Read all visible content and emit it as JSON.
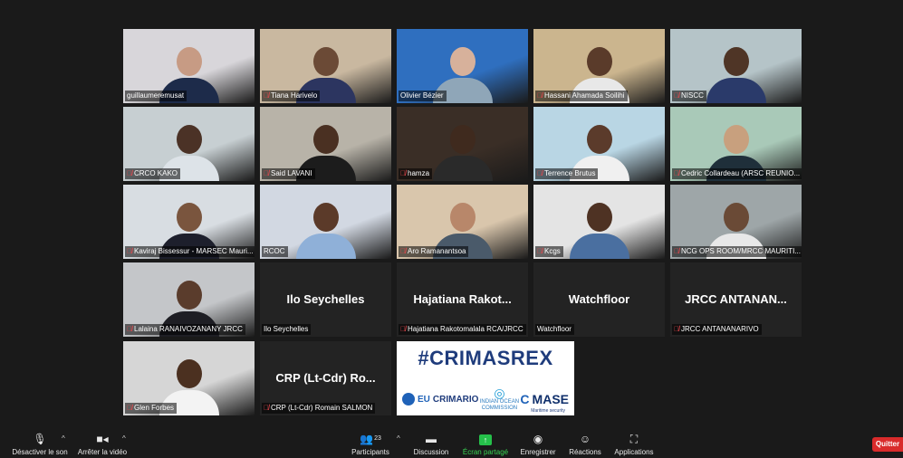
{
  "participants": [
    {
      "id": "t1",
      "name": "guillaumeremusat",
      "muted": false,
      "bg": "#d8d6da",
      "skin": "#c79b84",
      "shirt": "#1d2b4a"
    },
    {
      "id": "t2",
      "name": "Tiana Harivelo",
      "muted": true,
      "bg": "#c9b8a0",
      "skin": "#6b4a36",
      "shirt": "#2c3560"
    },
    {
      "id": "t3",
      "name": "Olivier Bézier",
      "muted": false,
      "bg": "#2f6fbf",
      "skin": "#d7b19b",
      "shirt": "#8fa6b8"
    },
    {
      "id": "t4",
      "name": "Hassani Ahamada Soilihi",
      "muted": true,
      "bg": "#cbb58e",
      "skin": "#5a3b2a",
      "shirt": "#e8e8e8"
    },
    {
      "id": "t5",
      "name": "NISCC",
      "muted": true,
      "bg": "#b5c4c8",
      "skin": "#4f3526",
      "shirt": "#2a3a6a"
    },
    {
      "id": "t6",
      "name": "CRCO KAKO",
      "muted": true,
      "bg": "#c7cfd2",
      "skin": "#4b3226",
      "shirt": "#dde3e8"
    },
    {
      "id": "t7",
      "name": "Said LAVANI",
      "muted": true,
      "bg": "#b8b3a8",
      "skin": "#4a3022",
      "shirt": "#1c1c1c"
    },
    {
      "id": "t8",
      "name": "hamza",
      "muted": true,
      "bg": "#3a2e26",
      "skin": "#3f2a1e",
      "shirt": "#2a2a2a"
    },
    {
      "id": "t9",
      "name": "Terrence Brutus",
      "muted": true,
      "bg": "#b9d6e4",
      "skin": "#5b3b2b",
      "shirt": "#f0f0f0"
    },
    {
      "id": "t10",
      "name": "Cedric Collardeau (ARSC REUNIO...",
      "muted": true,
      "bg": "#a9c9b8",
      "skin": "#c8a07e",
      "shirt": "#1f2f3a"
    },
    {
      "id": "t11",
      "name": "Kaviraj Bissessur - MARSEC Mauri...",
      "muted": true,
      "bg": "#d8dde2",
      "skin": "#7a553e",
      "shirt": "#1d1f2c"
    },
    {
      "id": "t12",
      "name": "RCOC",
      "muted": false,
      "bg": "#d2d8e2",
      "skin": "#5b3a29",
      "shirt": "#8fb0d8"
    },
    {
      "id": "t13",
      "name": "Aro Ramanantsoa",
      "muted": true,
      "bg": "#d9c6ac",
      "skin": "#b8876a",
      "shirt": "#4a5a6a"
    },
    {
      "id": "t14",
      "name": "Kcgs",
      "muted": true,
      "bg": "#e4e4e4",
      "skin": "#4e3223",
      "shirt": "#4a6fa0"
    },
    {
      "id": "t15",
      "name": "NCG OPS ROOM/MRCC MAURITI...",
      "muted": true,
      "bg": "#9ea6a8",
      "skin": "#6a4a36",
      "shirt": "#e8e8e8"
    },
    {
      "id": "t16",
      "name": "Lalaina RANAIVOZANANY JRCC",
      "muted": true,
      "bg": "#c4c6c9",
      "skin": "#5a3c2c",
      "shirt": "#1e1e24"
    },
    {
      "id": "t17",
      "name": "Ilo Seychelles",
      "muted": false,
      "big": "Ilo Seychelles"
    },
    {
      "id": "t18",
      "name": "Hajatiana Rakotomalala RCA/JRCC",
      "muted": true,
      "big": "Hajatiana  Rakot..."
    },
    {
      "id": "t19",
      "name": "Watchfloor",
      "muted": false,
      "big": "Watchfloor"
    },
    {
      "id": "t20",
      "name": "JRCC ANTANANARIVO",
      "muted": true,
      "big": "JRCC  ANTANAN..."
    },
    {
      "id": "t21",
      "name": "Glen Forbes",
      "muted": true,
      "bg": "#d6d6d6",
      "skin": "#4b3020",
      "shirt": "#f3f3f3"
    },
    {
      "id": "t22",
      "name": "CRP (Lt-Cdr) Romain SALMON",
      "muted": true,
      "big": "CRP (Lt-Cdr) Ro..."
    }
  ],
  "shared_screen": {
    "hashtag": "#CRIMASREX",
    "logo1": "CRIMARIO",
    "logo1_prefix": "EU",
    "logo2": "INDIAN OCEAN COMMISSION",
    "logo3": "MASE",
    "logo3_sub": "Maritime security"
  },
  "toolbar": {
    "mute": "Désactiver le son",
    "video": "Arrêter la vidéo",
    "participants": "Participants",
    "participants_count": "23",
    "chat": "Discussion",
    "share": "Écran partagé",
    "record": "Enregistrer",
    "reactions": "Réactions",
    "apps": "Applications",
    "quit": "Quitter"
  }
}
